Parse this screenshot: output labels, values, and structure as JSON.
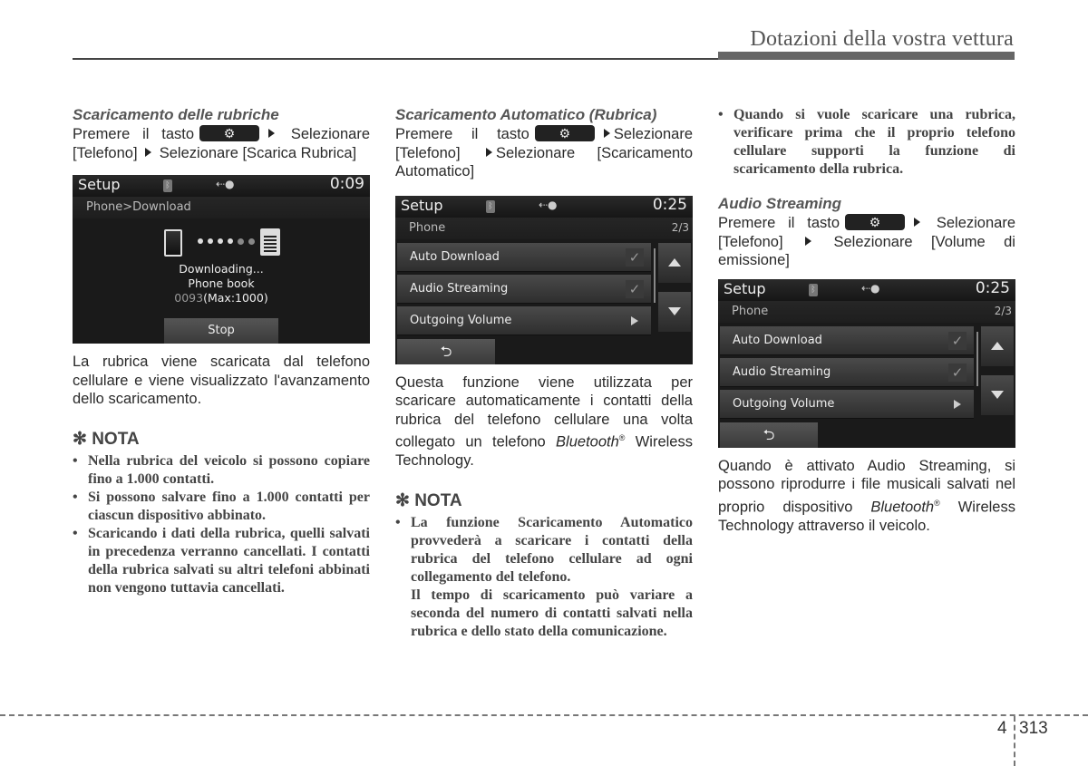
{
  "header": {
    "title": "Dotazioni della vostra vettura"
  },
  "columns": {
    "col1": {
      "section_title": "Scaricamento delle rubriche",
      "instr_pre": "Premere il tasto",
      "instr_mid": "Selezionare [Telefono]",
      "instr_post": "Selezionare [Scarica Rubrica]",
      "screen": {
        "title": "Setup",
        "time": "0:09",
        "breadcrumb": "Phone>Download",
        "status_line1": "Downloading...",
        "status_line2": "Phone book",
        "count": "0093",
        "max": "(Max:1000)",
        "stop_label": "Stop"
      },
      "description": "La rubrica viene scaricata dal telefono cellulare e viene visualizzato l'avanzamento dello scaricamento.",
      "note_title": "NOTA",
      "notes": [
        "Nella rubrica del veicolo si possono copiare fino a 1.000 contatti.",
        "Si possono salvare fino a 1.000 contatti per ciascun dispositivo abbinato.",
        "Scaricando i dati della rubrica, quelli salvati in precedenza verranno cancellati. I contatti della rubrica salvati su altri telefoni abbinati non vengono tuttavia cancellati."
      ]
    },
    "col2": {
      "section_title": "Scaricamento Automatico (Rubrica)",
      "instr_pre": "Premere il tasto",
      "instr_mid": "Selezionare [Telefono]",
      "instr_post": "Selezionare [Scaricamento Automatico]",
      "screen": {
        "title": "Setup",
        "time": "0:25",
        "subtitle": "Phone",
        "page": "2/3",
        "items": [
          "Auto Download",
          "Audio Streaming",
          "Outgoing Volume"
        ],
        "check_glyph": "✓",
        "back_glyph": "⮌"
      },
      "description_pre": "Questa funzione viene utilizzata per scaricare automaticamente i contatti della rubrica del telefono cellulare una volta collegato un telefono",
      "bluetooth": "Bluetooth",
      "reg": "®",
      "description_post": "Wireless Technology.",
      "note_title": "NOTA",
      "notes": [
        "La funzione Scaricamento Automatico provvederà a scaricare i contatti della rubrica del telefono cellulare ad ogni collegamento del telefono.",
        "Il tempo di scaricamento può variare a seconda del numero di contatti salvati nella rubrica e dello stato della comunicazione."
      ]
    },
    "col3": {
      "top_note": "Quando si vuole scaricare una rubrica, verificare prima che il proprio telefono cellulare supporti la funzione di scaricamento della rubrica.",
      "section_title": "Audio Streaming",
      "instr_pre": "Premere il tasto",
      "instr_mid": "Selezionare [Telefono]",
      "instr_post": "Selezionare [Volume di emissione]",
      "screen": {
        "title": "Setup",
        "time": "0:25",
        "subtitle": "Phone",
        "page": "2/3",
        "items": [
          "Auto Download",
          "Audio Streaming",
          "Outgoing Volume"
        ],
        "check_glyph": "✓",
        "back_glyph": "⮌"
      },
      "description_pre": "Quando è attivato Audio Streaming, si possono riprodurre i file musicali salvati nel proprio dispositivo",
      "bluetooth": "Bluetooth",
      "reg": "®",
      "description_post": "Wireless Technology attraverso il veicolo."
    }
  },
  "icons": {
    "gear": "⚙",
    "star": "✻",
    "usb": "⭠"
  },
  "footer": {
    "chapter": "4",
    "page": "313"
  }
}
